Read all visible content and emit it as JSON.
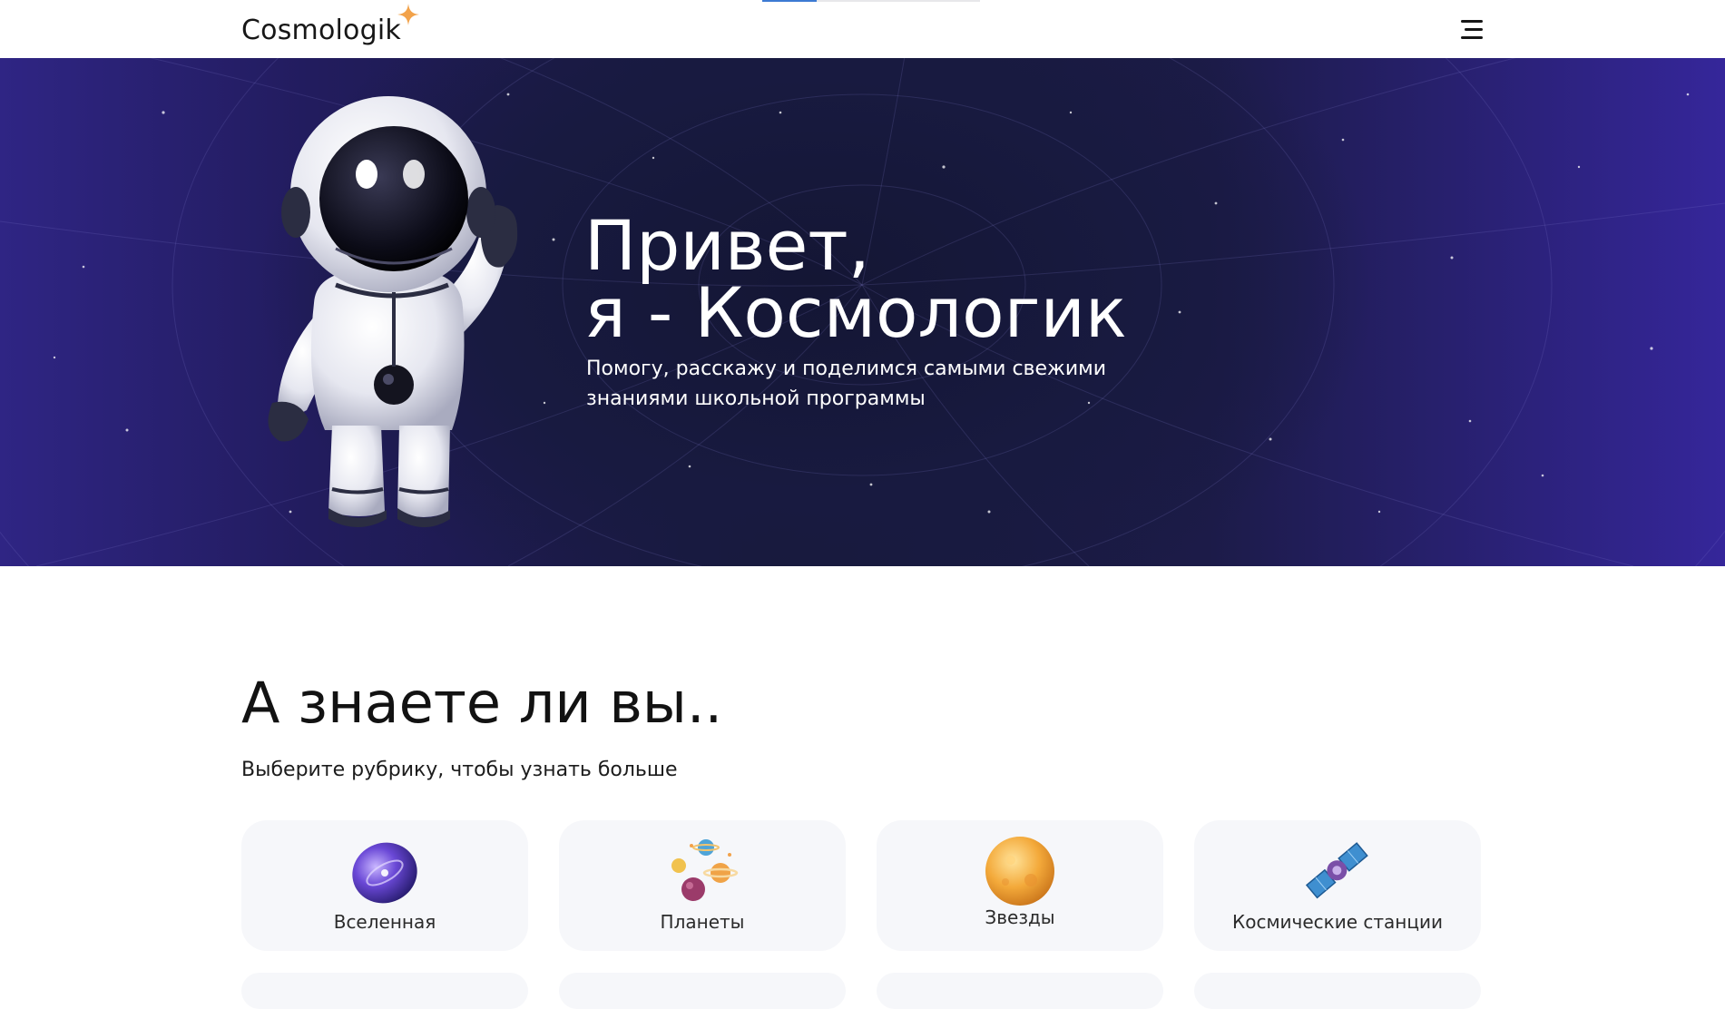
{
  "header": {
    "logo_text": "Cosmologik",
    "scroll_progress": 0.25,
    "menu_icon": "hamburger-menu-icon"
  },
  "hero": {
    "title_line1": "Привет,",
    "title_line2": "я - Космологик",
    "subtitle_line1": "Помогу, расскажу и поделимся самыми свежими",
    "subtitle_line2": "знаниями школьной программы"
  },
  "section": {
    "title": "А знаете ли вы..",
    "subtitle": "Выберите рубрику, чтобы узнать больше"
  },
  "categories": [
    {
      "label": "Вселенная",
      "icon": "galaxy-icon"
    },
    {
      "label": "Планеты",
      "icon": "planets-icon"
    },
    {
      "label": "Звезды",
      "icon": "star-sun-icon"
    },
    {
      "label": "Космические станции",
      "icon": "space-station-icon"
    }
  ],
  "colors": {
    "brand_star": "#f2a24a",
    "hero_dark": "#17193a",
    "hero_purple": "#35269a",
    "card_bg": "#f6f7fa",
    "progress": "#3d7bd3"
  }
}
